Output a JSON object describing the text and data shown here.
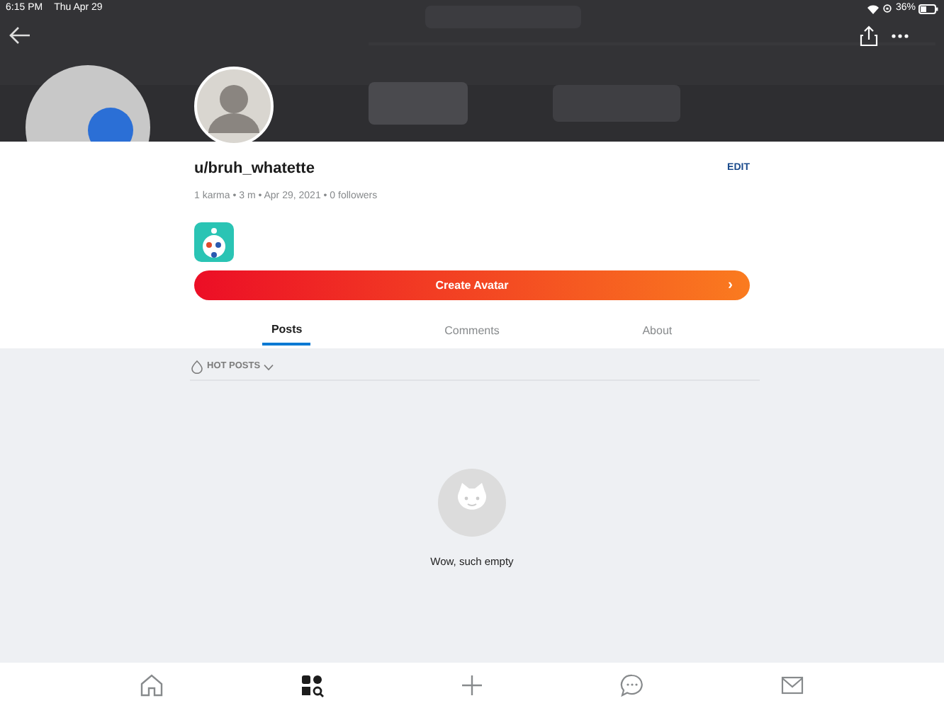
{
  "status_bar": {
    "time": "6:15 PM",
    "date": "Thu Apr 29",
    "battery": "36%"
  },
  "profile": {
    "username": "u/bruh_whatette",
    "edit": "EDIT",
    "meta": "1 karma • 3 m • Apr 29, 2021 • 0 followers",
    "create_avatar": "Create Avatar",
    "chevron": "›"
  },
  "tabs": [
    {
      "label": "Posts",
      "selected": true
    },
    {
      "label": "Comments",
      "selected": false
    },
    {
      "label": "About",
      "selected": false
    }
  ],
  "sort": {
    "label": "HOT POSTS"
  },
  "empty": {
    "message": "Wow, such empty"
  },
  "bottom_nav": [
    {
      "kind": "home",
      "selected": false
    },
    {
      "kind": "discover",
      "selected": true
    },
    {
      "kind": "create",
      "selected": false
    },
    {
      "kind": "chat",
      "selected": false
    },
    {
      "kind": "inbox",
      "selected": false
    }
  ]
}
